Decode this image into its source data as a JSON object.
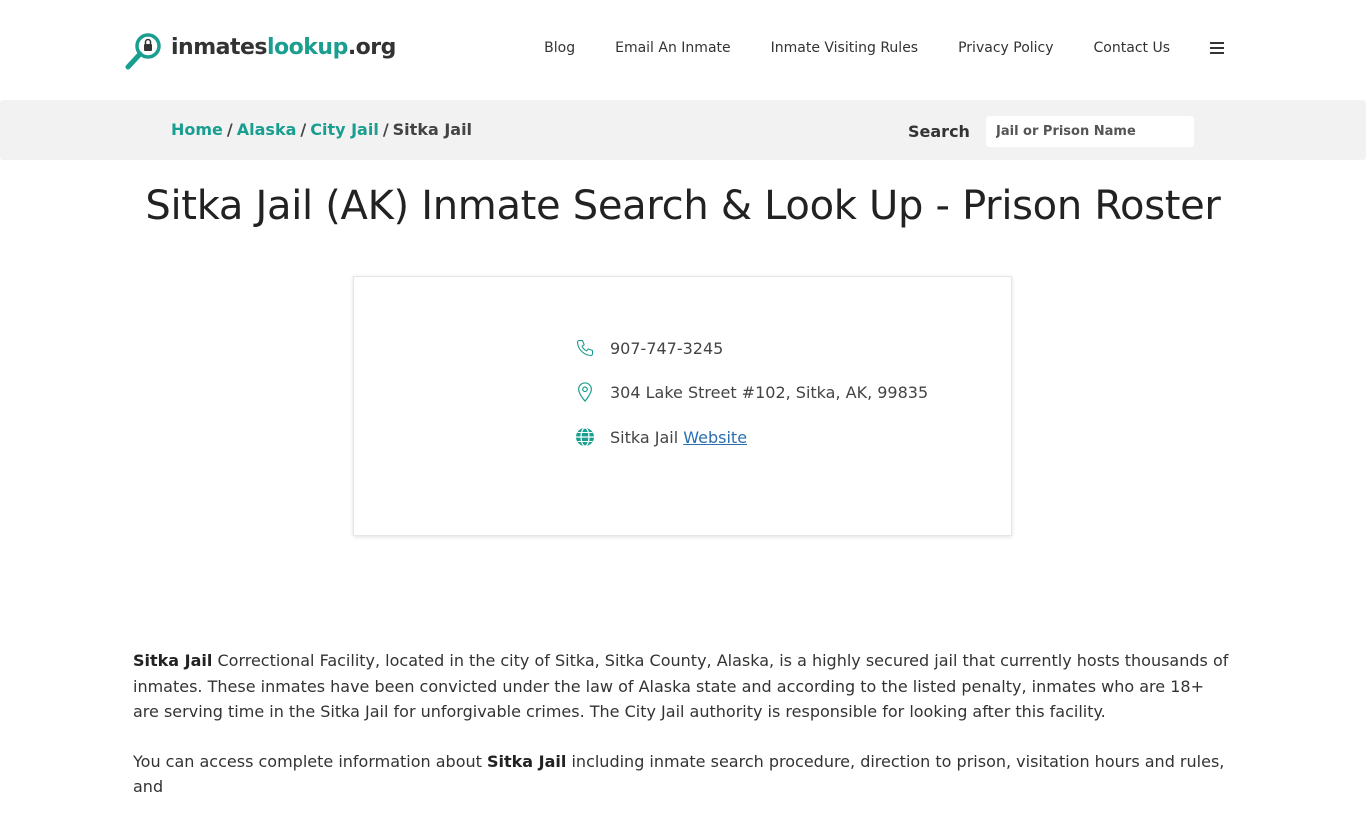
{
  "header": {
    "logo": {
      "part1": "inmates",
      "part2": "lookup",
      "part3": ".org"
    },
    "nav": [
      {
        "label": "Blog"
      },
      {
        "label": "Email An Inmate"
      },
      {
        "label": "Inmate Visiting Rules"
      },
      {
        "label": "Privacy Policy"
      },
      {
        "label": "Contact Us"
      }
    ],
    "menu_icon": "hamburger-icon"
  },
  "breadcrumb": {
    "items": [
      "Home",
      "Alaska",
      "City Jail"
    ],
    "current": "Sitka Jail",
    "separator": "/"
  },
  "search": {
    "label": "Search",
    "placeholder": "Jail or Prison Name"
  },
  "page_title": "Sitka Jail (AK) Inmate Search & Look Up - Prison Roster",
  "card": {
    "phone": "907-747-3245",
    "address": "304 Lake Street #102, Sitka, AK, 99835",
    "website_prefix": "Sitka Jail",
    "website_link": "Website",
    "icons": [
      "phone-icon",
      "map-pin-icon",
      "globe-icon"
    ]
  },
  "content": {
    "p1_bold": "Sitka Jail",
    "p1_text": " Correctional Facility, located in the city of Sitka, Sitka County, Alaska, is a highly secured jail that currently hosts thousands of inmates. These inmates have been convicted under the law of Alaska state and according to the listed penalty, inmates who are 18+ are serving time in the Sitka Jail for unforgivable crimes. The City Jail authority is responsible for looking after this facility.",
    "p2_start": "You can access complete information about ",
    "p2_bold": "Sitka Jail",
    "p2_rest": " including inmate search procedure, direction to prison, visitation hours and rules, and"
  },
  "colors": {
    "accent": "#1a9e8f",
    "link": "#2a6fb0",
    "crumb_bar": "#f2f2f2"
  }
}
